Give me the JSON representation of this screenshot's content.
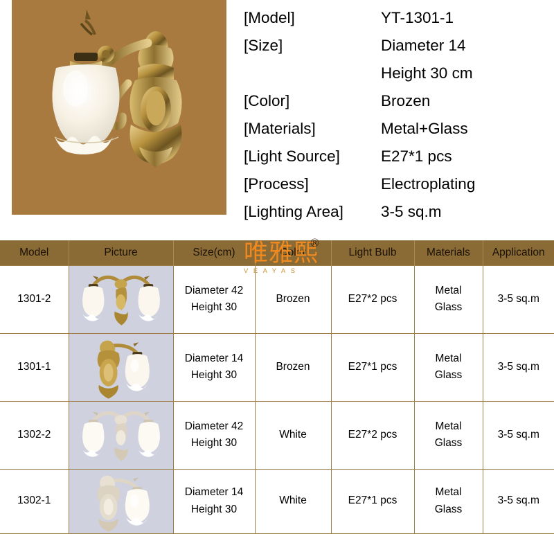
{
  "hero": {
    "alt": "brass-wall-sconce-photo",
    "background_color": "#a87a40"
  },
  "specs": [
    {
      "label": "[Model]",
      "value": "YT-1301-1"
    },
    {
      "label": "[Size]",
      "value": "Diameter 14"
    },
    {
      "label": "",
      "value": "Height 30 cm"
    },
    {
      "label": "[Color]",
      "value": "Brozen"
    },
    {
      "label": "[Materials]",
      "value": "Metal+Glass"
    },
    {
      "label": "[Light Source]",
      "value": "E27*1 pcs"
    },
    {
      "label": "[Process]",
      "value": "Electroplating"
    },
    {
      "label": "[Lighting Area]",
      "value": "3-5 sq.m"
    }
  ],
  "table": {
    "header_background": "#8a6a35",
    "picture_cell_background": "#cfd2de",
    "border_color": "#9b7d43",
    "columns": [
      "Model",
      "Picture",
      "Size(cm)",
      "Color",
      "Light Bulb",
      "Materials",
      "Application"
    ],
    "rows": [
      {
        "model": "1301-2",
        "picture": "wall-sconce-two-light-brass",
        "size": "Diameter 42\nHeight 30",
        "color": "Brozen",
        "bulb": "E27*2 pcs",
        "materials": "Metal\nGlass",
        "application": "3-5 sq.m"
      },
      {
        "model": "1301-1",
        "picture": "wall-sconce-one-light-brass",
        "size": "Diameter 14\nHeight 30",
        "color": "Brozen",
        "bulb": "E27*1 pcs",
        "materials": "Metal\nGlass",
        "application": "3-5 sq.m"
      },
      {
        "model": "1302-2",
        "picture": "wall-sconce-two-light-white",
        "size": "Diameter 42\nHeight 30",
        "color": "White",
        "bulb": "E27*2 pcs",
        "materials": "Metal\nGlass",
        "application": "3-5 sq.m"
      },
      {
        "model": "1302-1",
        "picture": "wall-sconce-one-light-white",
        "size": "Diameter 14\nHeight 30",
        "color": "White",
        "bulb": "E27*1 pcs",
        "materials": "Metal\nGlass",
        "application": "3-5 sq.m"
      }
    ]
  },
  "watermark": {
    "characters": "唯雅熙",
    "latin": "VEAYAS",
    "registered_mark": "®",
    "color": "#f08a1e"
  }
}
